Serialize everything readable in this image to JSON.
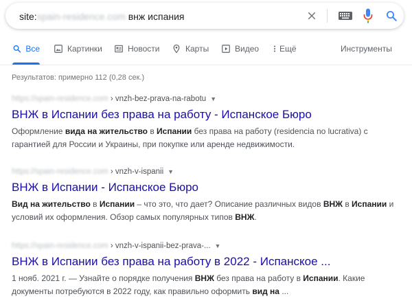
{
  "search": {
    "site_prefix": "site:",
    "site_domain": "spain-residence.com",
    "query_terms": " внж испания"
  },
  "tabs": [
    {
      "label": "Все",
      "icon": "search-icon",
      "active": true
    },
    {
      "label": "Картинки",
      "icon": "image-icon"
    },
    {
      "label": "Новости",
      "icon": "newspaper-icon"
    },
    {
      "label": "Карты",
      "icon": "map-pin-icon"
    },
    {
      "label": "Видео",
      "icon": "play-icon"
    },
    {
      "label": "Ещё",
      "icon": "more-vert-icon"
    },
    {
      "label": "Инструменты"
    }
  ],
  "stats": "Результатов: примерно 112 (0,28 сек.)",
  "results": [
    {
      "domain": "https://spain-residence.com",
      "separator": " › ",
      "path": "vnzh-bez-prava-na-rabotu",
      "title": "ВНЖ в Испании без права на работу - Испанское Бюро",
      "snippet": [
        [
          "Оформление ",
          ""
        ],
        [
          "вида на жительство",
          "b"
        ],
        [
          " в ",
          ""
        ],
        [
          "Испании",
          "b"
        ],
        [
          " без права на работу (residencia no lucrativa) с гарантией для России и Украины, при покупке или аренде недвижимости.",
          ""
        ]
      ]
    },
    {
      "domain": "https://spain-residence.com",
      "separator": " › ",
      "path": "vnzh-v-ispanii",
      "title": "ВНЖ в Испании - Испанское Бюро",
      "snippet": [
        [
          "Вид на жительство",
          "b"
        ],
        [
          " в ",
          ""
        ],
        [
          "Испании",
          "b"
        ],
        [
          " – что это, что дает? Описание различных видов ",
          ""
        ],
        [
          "ВНЖ",
          "b"
        ],
        [
          " в ",
          ""
        ],
        [
          "Испании",
          "b"
        ],
        [
          " и условий их оформления. Обзор самых популярных типов ",
          ""
        ],
        [
          "ВНЖ",
          "b"
        ],
        [
          ".",
          ""
        ]
      ]
    },
    {
      "domain": "https://spain-residence.com",
      "separator": " › ",
      "path": "vnzh-v-ispanii-bez-prava-...",
      "title": "ВНЖ в Испании без права на работу в 2022 - Испанское ...",
      "snippet": [
        [
          "1 нояб. 2021 г. — Узнайте о порядке получения ",
          ""
        ],
        [
          "ВНЖ",
          "b"
        ],
        [
          " без права на работу в ",
          ""
        ],
        [
          "Испании",
          "b"
        ],
        [
          ". Какие документы потребуются в 2022 году, как правильно оформить ",
          ""
        ],
        [
          "вид на",
          "b"
        ],
        [
          " ...",
          ""
        ]
      ]
    }
  ],
  "colors": {
    "link": "#1a0dab",
    "accent": "#1a73e8",
    "mic_blue": "#4285f4",
    "mic_red": "#ea4335",
    "mic_yellow": "#fbbc04",
    "mic_green": "#34a853"
  }
}
